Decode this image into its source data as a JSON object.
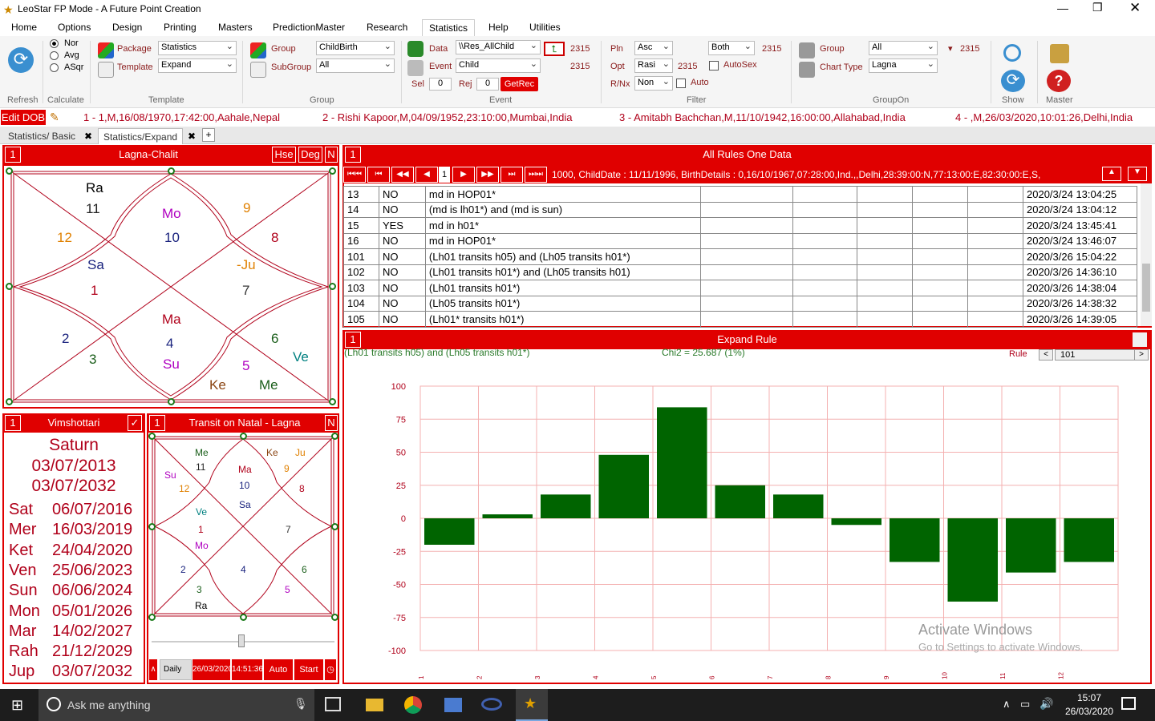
{
  "window": {
    "title": "LeoStar FP Mode - A Future Point Creation"
  },
  "menu": [
    "Home",
    "Options",
    "Design",
    "Printing",
    "Masters",
    "PredictionMaster",
    "Research",
    "Statistics",
    "Help",
    "Utilities"
  ],
  "ribbon": {
    "refresh_label": "Refresh",
    "calc_label": "Calculate",
    "calc_options": [
      "Nor",
      "Avg",
      "ASqr"
    ],
    "template_group": "Template",
    "package_label": "Package",
    "package_value": "Statistics",
    "template_label": "Template",
    "template_value": "Expand",
    "group_group": "Group",
    "group_label": "Group",
    "group_value": "ChildBirth",
    "subgroup_label": "SubGroup",
    "subgroup_value": "All",
    "event_group": "Event",
    "data_label": "Data",
    "data_value": "\\\\Res_AllChild",
    "event_label": "Event",
    "event_value": "Child",
    "count1": "2315",
    "count2": "2315",
    "sel_label": "Sel",
    "sel_value": "0",
    "rej_label": "Rej",
    "rej_value": "0",
    "getrec": "GetRec",
    "filter_group": "Filter",
    "pln_label": "Pln",
    "pln_value": "Asc",
    "opt_label": "Opt",
    "opt_value": "Rasi",
    "rnx_label": "R/Nx",
    "rnx_value": "Non",
    "both_value": "Both",
    "count3": "2315",
    "count4": "2315",
    "autosex": "AutoSex",
    "auto": "Auto",
    "groupon_group": "GroupOn",
    "go_group_label": "Group",
    "go_group_value": "All",
    "chart_type_label": "Chart Type",
    "chart_type_value": "Lagna",
    "count5": "2315",
    "show_label": "Show",
    "master_label": "Master"
  },
  "ticker": {
    "edit_dob": "Edit DOB",
    "items": [
      "1 - 1,M,16/08/1970,17:42:00,Aahale,Nepal",
      "2 - Rishi Kapoor,M,04/09/1952,23:10:00,Mumbai,India",
      "3 - Amitabh Bachchan,M,11/10/1942,16:00:00,Allahabad,India",
      "4 - ,M,26/03/2020,10:01:26,Delhi,India"
    ]
  },
  "tabs": [
    "Statistics/ Basic",
    "Statistics/Expand"
  ],
  "lagna": {
    "num": "1",
    "title": "Lagna-Chalit",
    "hse": "Hse",
    "deg": "Deg",
    "n": "N",
    "cells": [
      {
        "t": "Ra",
        "c": "#000"
      },
      {
        "t": "11",
        "c": "#222"
      },
      {
        "t": "Mo",
        "c": "#b000c0"
      },
      {
        "t": "10",
        "c": "#1a237e"
      },
      {
        "t": "9",
        "c": "#e08000"
      },
      {
        "t": "12",
        "c": "#e08000"
      },
      {
        "t": "8",
        "c": "#b0001a"
      },
      {
        "t": "Sa",
        "c": "#1a237e"
      },
      {
        "t": "1",
        "c": "#b0001a"
      },
      {
        "t": "-Ju",
        "c": "#e08000"
      },
      {
        "t": "7",
        "c": "#333"
      },
      {
        "t": "Ma",
        "c": "#b0001a"
      },
      {
        "t": "4",
        "c": "#1a237e"
      },
      {
        "t": "2",
        "c": "#1a237e"
      },
      {
        "t": "6",
        "c": "#1a5e1a"
      },
      {
        "t": "Su",
        "c": "#b000c0"
      },
      {
        "t": "Ve",
        "c": "#008080"
      },
      {
        "t": "3",
        "c": "#1a5e1a"
      },
      {
        "t": "5",
        "c": "#b000c0"
      },
      {
        "t": "Ke",
        "c": "#8b4513"
      },
      {
        "t": "Me",
        "c": "#1a5e1a"
      }
    ]
  },
  "vimsh": {
    "num": "1",
    "title": "Vimshottari",
    "check": "✓",
    "planet": "Saturn",
    "start": "03/07/2013",
    "end": "03/07/2032",
    "rows": [
      {
        "p": "Sat",
        "d": "06/07/2016"
      },
      {
        "p": "Mer",
        "d": "16/03/2019"
      },
      {
        "p": "Ket",
        "d": "24/04/2020"
      },
      {
        "p": "Ven",
        "d": "25/06/2023"
      },
      {
        "p": "Sun",
        "d": "06/06/2024"
      },
      {
        "p": "Mon",
        "d": "05/01/2026"
      },
      {
        "p": "Mar",
        "d": "14/02/2027"
      },
      {
        "p": "Rah",
        "d": "21/12/2029"
      },
      {
        "p": "Jup",
        "d": "03/07/2032"
      }
    ]
  },
  "transit": {
    "num": "1",
    "title": "Transit on Natal - Lagna",
    "n": "N",
    "cells": [
      {
        "t": "Me",
        "c": "#1a5e1a"
      },
      {
        "t": "11",
        "c": "#222"
      },
      {
        "t": "Ma",
        "c": "#b0001a"
      },
      {
        "t": "10",
        "c": "#1a237e"
      },
      {
        "t": "Sa",
        "c": "#1a237e"
      },
      {
        "t": "Ke",
        "c": "#8b4513"
      },
      {
        "t": "Ju",
        "c": "#e08000"
      },
      {
        "t": "9",
        "c": "#e08000"
      },
      {
        "t": "Su",
        "c": "#b000c0"
      },
      {
        "t": "12",
        "c": "#e08000"
      },
      {
        "t": "8",
        "c": "#b0001a"
      },
      {
        "t": "Ve",
        "c": "#008080"
      },
      {
        "t": "1",
        "c": "#b0001a"
      },
      {
        "t": "Mo",
        "c": "#b000c0"
      },
      {
        "t": "7",
        "c": "#333"
      },
      {
        "t": "2",
        "c": "#1a237e"
      },
      {
        "t": "4",
        "c": "#1a237e"
      },
      {
        "t": "6",
        "c": "#1a5e1a"
      },
      {
        "t": "5",
        "c": "#b000c0"
      },
      {
        "t": "3",
        "c": "#1a5e1a"
      },
      {
        "t": "Ra",
        "c": "#000"
      }
    ],
    "controls": {
      "mode": "Daily",
      "date": "26/03/2020",
      "time": "14:51:36",
      "auto": "Auto",
      "start": "Start"
    }
  },
  "rules": {
    "num": "1",
    "title": "All Rules One Data",
    "page": "1",
    "record": "1000, ChildDate : 11/11/1996, BirthDetails : 0,16/10/1967,07:28:00,Ind.,,Delhi,28:39:00:N,77:13:00:E,82:30:00:E,S,",
    "rows": [
      [
        "13",
        "NO",
        "md in HOP01*",
        "2020/3/24 13:04:25"
      ],
      [
        "14",
        "NO",
        "(md is lh01*) and (md is sun)",
        "2020/3/24 13:04:12"
      ],
      [
        "15",
        "YES",
        "md in h01*",
        "2020/3/24 13:45:41"
      ],
      [
        "16",
        "NO",
        "md in HOP01*",
        "2020/3/24 13:46:07"
      ],
      [
        "101",
        "NO",
        "(Lh01 transits h05) and (Lh05 transits h01*)",
        "2020/3/26 15:04:22"
      ],
      [
        "102",
        "NO",
        "(Lh01 transits h01*) and (Lh05 transits h01)",
        "2020/3/26 14:36:10"
      ],
      [
        "103",
        "NO",
        "(Lh01 transits h01*)",
        "2020/3/26 14:38:04"
      ],
      [
        "104",
        "NO",
        "(Lh05 transits h01*)",
        "2020/3/26 14:38:32"
      ],
      [
        "105",
        "NO",
        "(Lh01* transits h01*)",
        "2020/3/26 14:39:05"
      ]
    ]
  },
  "expand": {
    "num": "1",
    "title": "Expand Rule",
    "rule_text": "(Lh01 transits h05) and (Lh05 transits h01*)",
    "chi": "Chi2 = 25.687 (1%)",
    "rule_label": "Rule",
    "rule_value": "101"
  },
  "chart_data": {
    "type": "bar",
    "categories": [
      "1",
      "2",
      "3",
      "4",
      "5",
      "6",
      "7",
      "8",
      "9",
      "10",
      "11",
      "12"
    ],
    "values": [
      -20,
      3,
      18,
      48,
      84,
      25,
      18,
      -5,
      -33,
      -63,
      -41,
      -33
    ],
    "ylim": [
      -100,
      100
    ],
    "yticks": [
      "100",
      "75",
      "50",
      "25",
      "0",
      "-25",
      "-50",
      "-75",
      "-100"
    ],
    "bar_color": "#006400",
    "grid_color": "#f4b0b0"
  },
  "watermark": {
    "line1": "Activate Windows",
    "line2": "Go to Settings to activate Windows."
  },
  "taskbar": {
    "search": "Ask me anything",
    "time": "15:07",
    "date": "26/03/2020"
  }
}
